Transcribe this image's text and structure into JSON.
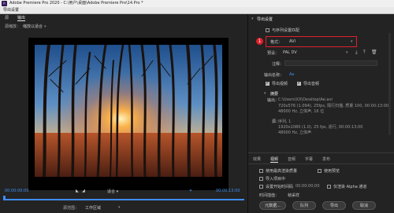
{
  "window": {
    "app_icon": "Pr",
    "title": "Adobe Premiere Pro 2020 - C:\\用户\\桌面\\Adobe Premiere Pro\\14.Pro *"
  },
  "dialog": {
    "title": "导出设置"
  },
  "left_panel": {
    "tabs": [
      "源",
      "输出"
    ],
    "source_scaling_label": "源缩放：",
    "source_scaling_value": "缩放以适合",
    "timecode_in": "00:00:00:00",
    "timecode_out": "00:00:13:00",
    "fit_label": "适合",
    "source_range_label": "源范围：",
    "source_range_value": "工作区域"
  },
  "right_panel": {
    "section_title": "导出设置",
    "match_sequence_label": "与序列设置匹配",
    "format_label": "格式：",
    "format_value": "AVI",
    "preset_label": "预设：",
    "preset_value": "PAL DV",
    "comments_label": "注释：",
    "output_name_label": "输出名称：",
    "output_name_value": "Ae",
    "export_video_label": "导出视频",
    "export_audio_label": "导出音频",
    "summary_title": "摘要",
    "summary_output_label": "输出：",
    "summary_output_lines": [
      "C:\\Users\\XX\\Desktop\\Ae.avi",
      "720x576 (1.094), 25fps, 隔行扫描, 质量 100, 00:00:13:00",
      "48000 Hz, 立体声, 16 位"
    ],
    "summary_source_label": "源：",
    "summary_source_lines": [
      "序列, 1",
      "1920x1080 (1.0), 25 fps, 逐行, 00:00:13:00",
      "48000 Hz, 立体声"
    ],
    "tabs": [
      "效果",
      "视频",
      "音频",
      "字幕",
      "发布"
    ],
    "use_max_render_quality": "使用最高渲染质量",
    "use_previews": "使用预览",
    "import_into_project": "导入项目中",
    "set_start_timecode": "设置开始时间码",
    "start_timecode_value": "00;00;00;00",
    "render_alpha_only": "仅渲染 Alpha 通道",
    "time_interpolation_label": "时间插值：",
    "time_interpolation_value": "帧采样",
    "buttons": {
      "metadata": "元数据...",
      "queue": "队列",
      "export": "导出",
      "cancel": "取消"
    },
    "callout_number": "1"
  },
  "colors": {
    "accent_blue": "#3f8cf0",
    "callout_red": "#e0202a"
  },
  "icons": [
    "save-preset-icon",
    "import-preset-icon",
    "delete-preset-icon",
    "add-marker-icon",
    "mark-in-icon",
    "mark-out-icon"
  ]
}
